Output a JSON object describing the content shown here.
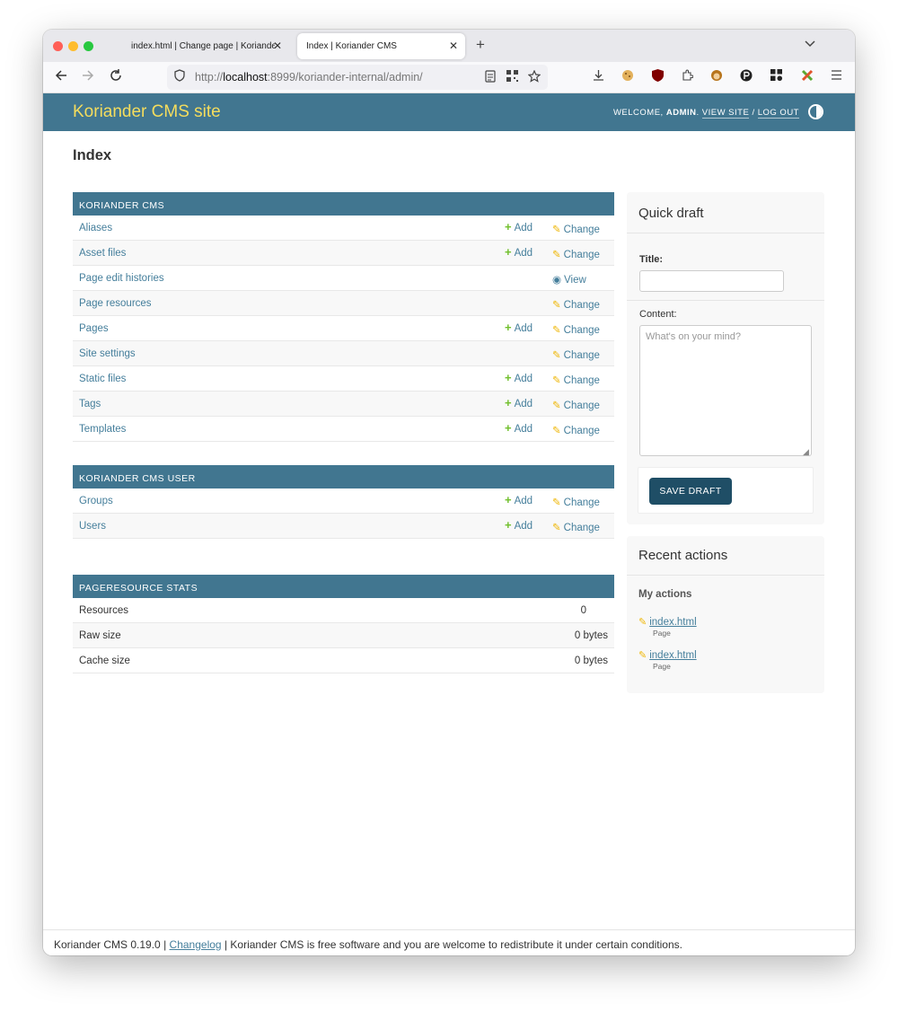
{
  "browser": {
    "tabs": [
      {
        "title": "index.html | Change page | Koriander CMS",
        "close": "✕"
      },
      {
        "title": "Index | Koriander CMS",
        "close": "✕"
      }
    ],
    "new_tab": "+",
    "tab_list": "⌄",
    "url_prefix": "http://",
    "url_host": "localhost",
    "url_rest": ":8999/koriander-internal/admin/",
    "traffic_colors": [
      "#ff5f57",
      "#febc2e",
      "#28c840"
    ]
  },
  "header": {
    "site_name": "Koriander CMS site",
    "welcome": "Welcome,",
    "user": "admin",
    "view_site": "View site",
    "separator": "/",
    "log_out": "Log out"
  },
  "page": {
    "title": "Index"
  },
  "apps": [
    {
      "caption": "Koriander CMS",
      "models": [
        {
          "name": "Aliases",
          "add": "Add",
          "change": "Change"
        },
        {
          "name": "Asset files",
          "add": "Add",
          "change": "Change"
        },
        {
          "name": "Page edit histories",
          "add": "",
          "change": "",
          "view": "View"
        },
        {
          "name": "Page resources",
          "add": "",
          "change": "Change"
        },
        {
          "name": "Pages",
          "add": "Add",
          "change": "Change"
        },
        {
          "name": "Site settings",
          "add": "",
          "change": "Change"
        },
        {
          "name": "Static files",
          "add": "Add",
          "change": "Change"
        },
        {
          "name": "Tags",
          "add": "Add",
          "change": "Change"
        },
        {
          "name": "Templates",
          "add": "Add",
          "change": "Change"
        }
      ]
    },
    {
      "caption": "Koriander CMS User",
      "models": [
        {
          "name": "Groups",
          "add": "Add",
          "change": "Change"
        },
        {
          "name": "Users",
          "add": "Add",
          "change": "Change"
        }
      ]
    }
  ],
  "stats": {
    "caption": "PageResource stats",
    "rows": [
      {
        "label": "Resources",
        "value": "0"
      },
      {
        "label": "Raw size",
        "value": "0 bytes"
      },
      {
        "label": "Cache size",
        "value": "0 bytes"
      }
    ]
  },
  "quick_draft": {
    "title": "Quick draft",
    "title_label": "Title:",
    "title_value": "",
    "content_label": "Content:",
    "content_placeholder": "What's on your mind?",
    "save": "Save draft"
  },
  "recent_actions": {
    "title": "Recent actions",
    "subtitle": "My actions",
    "items": [
      {
        "link": "index.html",
        "type": "Page"
      },
      {
        "link": "index.html",
        "type": "Page"
      }
    ]
  },
  "footer": {
    "version": "Koriander CMS 0.19.0 |",
    "changelog": "Changelog",
    "license": "| Koriander CMS is free software and you are welcome to redistribute it under certain conditions."
  },
  "colors": {
    "header_bg": "#417690",
    "site_name": "#f5dd5d",
    "link": "#447e9b",
    "add_icon": "#70bf2b",
    "change_icon": "#efb80b",
    "button": "#1f4e66"
  }
}
